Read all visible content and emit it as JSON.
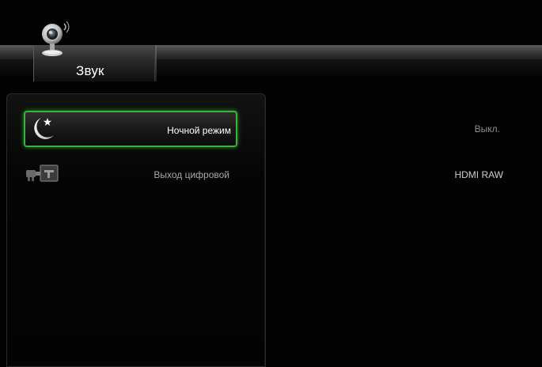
{
  "header": {
    "title": "Звук",
    "icon": "webcam-icon"
  },
  "menu": {
    "items": [
      {
        "label": "Ночной режим",
        "icon": "moon-star-icon",
        "value": "Выкл.",
        "selected": true
      },
      {
        "label": "Выход цифровой",
        "icon": "digital-output-icon",
        "value": "HDMI RAW",
        "selected": false
      }
    ]
  },
  "colors": {
    "selection_border": "#3bb33b",
    "background": "#000000"
  }
}
